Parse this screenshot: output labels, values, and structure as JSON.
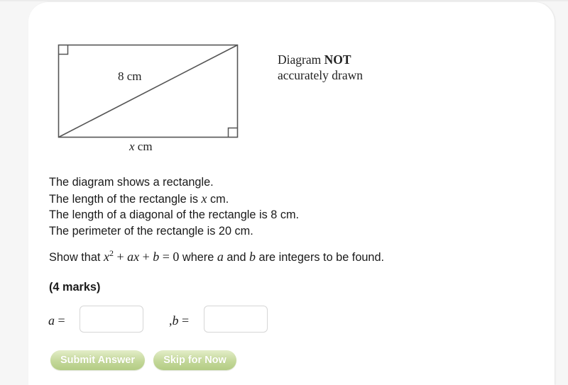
{
  "diagram": {
    "diagonal_label": "8 cm",
    "length_label_var": "x",
    "length_label_unit": " cm",
    "note_line1_normal": "Diagram ",
    "note_line1_bold": "NOT",
    "note_line2": "accurately drawn"
  },
  "problem": {
    "lines": [
      {
        "before": "The diagram shows a rectangle.",
        "math": "",
        "after": ""
      },
      {
        "before": "The length of the rectangle is ",
        "math": "x",
        "after": " cm."
      },
      {
        "before": "The length of a diagonal of the rectangle is 8 cm.",
        "math": "",
        "after": ""
      },
      {
        "before": "The perimeter of the rectangle is 20 cm.",
        "math": "",
        "after": ""
      }
    ],
    "question": {
      "prefix": "Show that ",
      "eq_x": "x",
      "eq_exp": "2",
      "eq_rest_1": " + ",
      "eq_a": "a",
      "eq_x2": "x",
      "eq_rest_2": " + ",
      "eq_b": "b",
      "eq_rest_3": " = 0",
      "middle": " where ",
      "var_a": "a",
      "and": " and ",
      "var_b": "b",
      "suffix": " are integers to be found."
    },
    "marks": "(4 marks)"
  },
  "answers": {
    "a_label_var": "a",
    "a_label_eq": " =",
    "a_value": "",
    "b_label_prefix": ",",
    "b_label_var": "b",
    "b_label_eq": " =",
    "b_value": ""
  },
  "buttons": {
    "submit": "Submit Answer",
    "skip": "Skip for Now"
  },
  "colors": {
    "button_green_light": "#e3edc8",
    "button_green_dark": "#b3cc84",
    "background": "#f6f6f6",
    "card": "#ffffff"
  }
}
